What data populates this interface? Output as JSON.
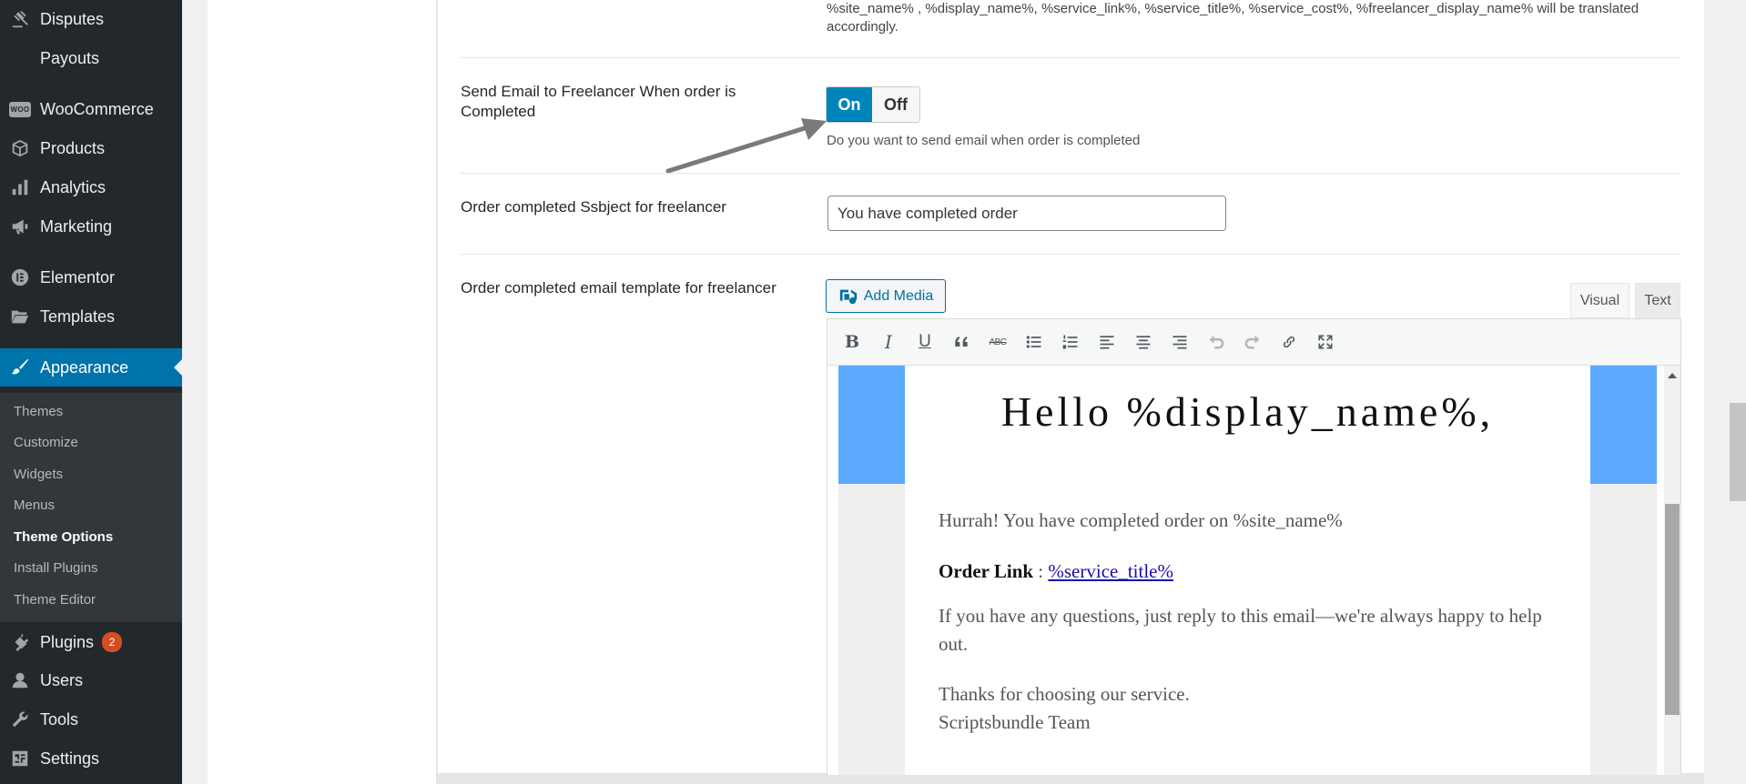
{
  "sidebar": {
    "menu": [
      {
        "id": "disputes",
        "label": "Disputes"
      },
      {
        "id": "payouts",
        "label": "Payouts"
      },
      {
        "id": "woocommerce",
        "label": "WooCommerce"
      },
      {
        "id": "products",
        "label": "Products"
      },
      {
        "id": "analytics",
        "label": "Analytics"
      },
      {
        "id": "marketing",
        "label": "Marketing"
      },
      {
        "id": "elementor",
        "label": "Elementor"
      },
      {
        "id": "templates",
        "label": "Templates"
      },
      {
        "id": "appearance",
        "label": "Appearance"
      },
      {
        "id": "plugins",
        "label": "Plugins",
        "badge": "2"
      },
      {
        "id": "users",
        "label": "Users"
      },
      {
        "id": "tools",
        "label": "Tools"
      },
      {
        "id": "settings",
        "label": "Settings"
      }
    ],
    "woo_icon_text": "WOO",
    "submenu": [
      {
        "label": "Themes"
      },
      {
        "label": "Customize"
      },
      {
        "label": "Widgets"
      },
      {
        "label": "Menus"
      },
      {
        "label": "Theme Options",
        "current": true
      },
      {
        "label": "Install Plugins"
      },
      {
        "label": "Theme Editor"
      }
    ]
  },
  "settings": {
    "top_description": "%site_name% , %display_name%, %service_link%, %service_title%, %service_cost%, %freelancer_display_name% will be translated accordingly.",
    "send_email": {
      "label": "Send Email to Freelancer When order is Completed",
      "on_label": "On",
      "off_label": "Off",
      "value": "On",
      "hint": "Do you want to send email when order is completed"
    },
    "subject": {
      "label": "Order completed Ssbject for freelancer",
      "value": "You have completed order"
    },
    "template": {
      "label": "Order completed email template for freelancer",
      "add_media": "Add Media",
      "tab_visual": "Visual",
      "tab_text": "Text"
    }
  },
  "email": {
    "heading": "Hello %display_name%,",
    "para1": "Hurrah! You have completed order on %site_name%",
    "order_link_label": "Order Link",
    "order_link_sep": " : ",
    "order_link_text": "%service_title%",
    "para3": "If you have any questions, just reply to this email—we're always happy to help out.",
    "thanks": "Thanks for choosing our service.",
    "team": "Scriptsbundle Team"
  },
  "colors": {
    "sidebar_bg": "#23282d",
    "submenu_bg": "#32373c",
    "accent": "#0073aa",
    "toggle_on": "#0085ba",
    "email_banner": "#5aa9ff",
    "badge": "#d54e21"
  }
}
